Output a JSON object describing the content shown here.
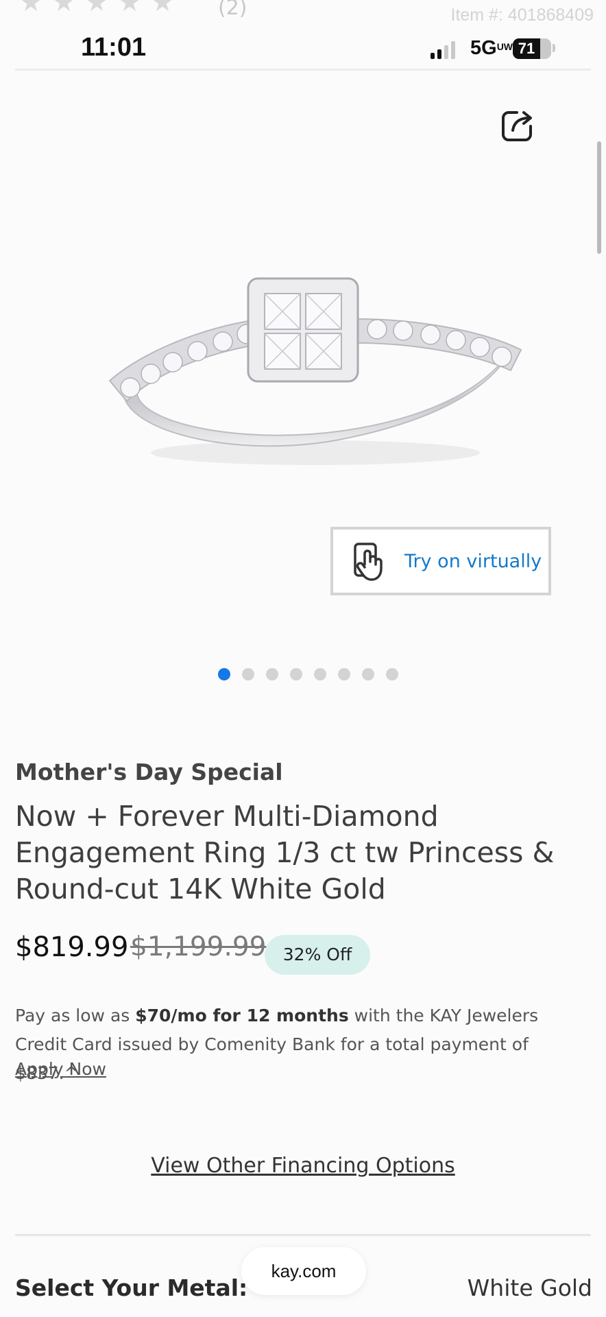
{
  "header_peek": {
    "rating_count": "(2)",
    "item_number": "Item #: 401868409"
  },
  "status_bar": {
    "time": "11:01",
    "network": "5G",
    "network_sup": "UW",
    "battery": "71",
    "battery_level": 0.71
  },
  "gallery": {
    "share_icon": "share-icon",
    "try_on_label": "Try on virtually",
    "try_on_icon": "hand-phone-icon",
    "dot_count": 8,
    "active_dot": 1
  },
  "product": {
    "promo": "Mother's Day Special",
    "title": "Now + Forever Multi-Diamond Engagement Ring 1/3 ct tw Princess & Round-cut 14K White Gold",
    "price": "$819.99",
    "original_price": "$1,199.99",
    "discount_badge": "32% Off",
    "discount_badge_color": "#d7f0ec"
  },
  "financing": {
    "text_before": "Pay as low as ",
    "text_bold": "$70/mo for 12 months",
    "text_after": " with the KAY Jewelers Credit Card issued by Comenity Bank for a total payment of $837.^",
    "apply_link": "Apply Now",
    "other_options_link": "View Other Financing Options"
  },
  "metal": {
    "label": "Select Your Metal:",
    "value": "White Gold"
  },
  "browser": {
    "url": "kay.com"
  },
  "colors": {
    "accent_blue": "#1479c9",
    "active_dot": "#1677e6"
  }
}
